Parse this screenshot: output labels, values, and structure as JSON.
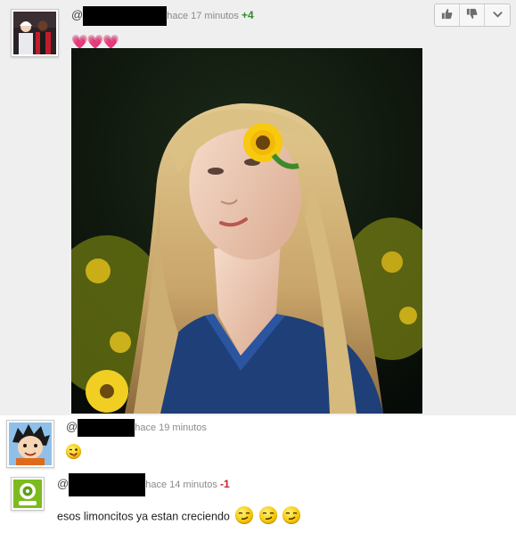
{
  "comments": [
    {
      "at": "@",
      "time": "hace 17 minutos",
      "score": "+4",
      "hearts": "💗💗💗",
      "avatar_icon": "avatar-couple-icon",
      "attachment_icon": "photo-girl-sunflower-icon"
    },
    {
      "at": "@",
      "time": "hace 19 minutos",
      "score": "",
      "avatar_icon": "avatar-cartoon-boy-icon",
      "body_emoji": "tongue-wink-emoji"
    },
    {
      "at": "@",
      "time": "hace 14 minutos",
      "score": "-1",
      "avatar_icon": "avatar-green-logo-icon",
      "body": "esos limoncitos ya estan creciendo",
      "body_emoji": "smirk-emoji"
    }
  ],
  "votes": {
    "up_icon": "thumbs-up-icon",
    "down_icon": "thumbs-down-icon",
    "more_icon": "chevron-down-icon"
  },
  "colors": {
    "highlight_bg": "#efefef",
    "positive": "#2f8c2f",
    "negative": "#cc2222",
    "hearts": "#e0409a"
  }
}
